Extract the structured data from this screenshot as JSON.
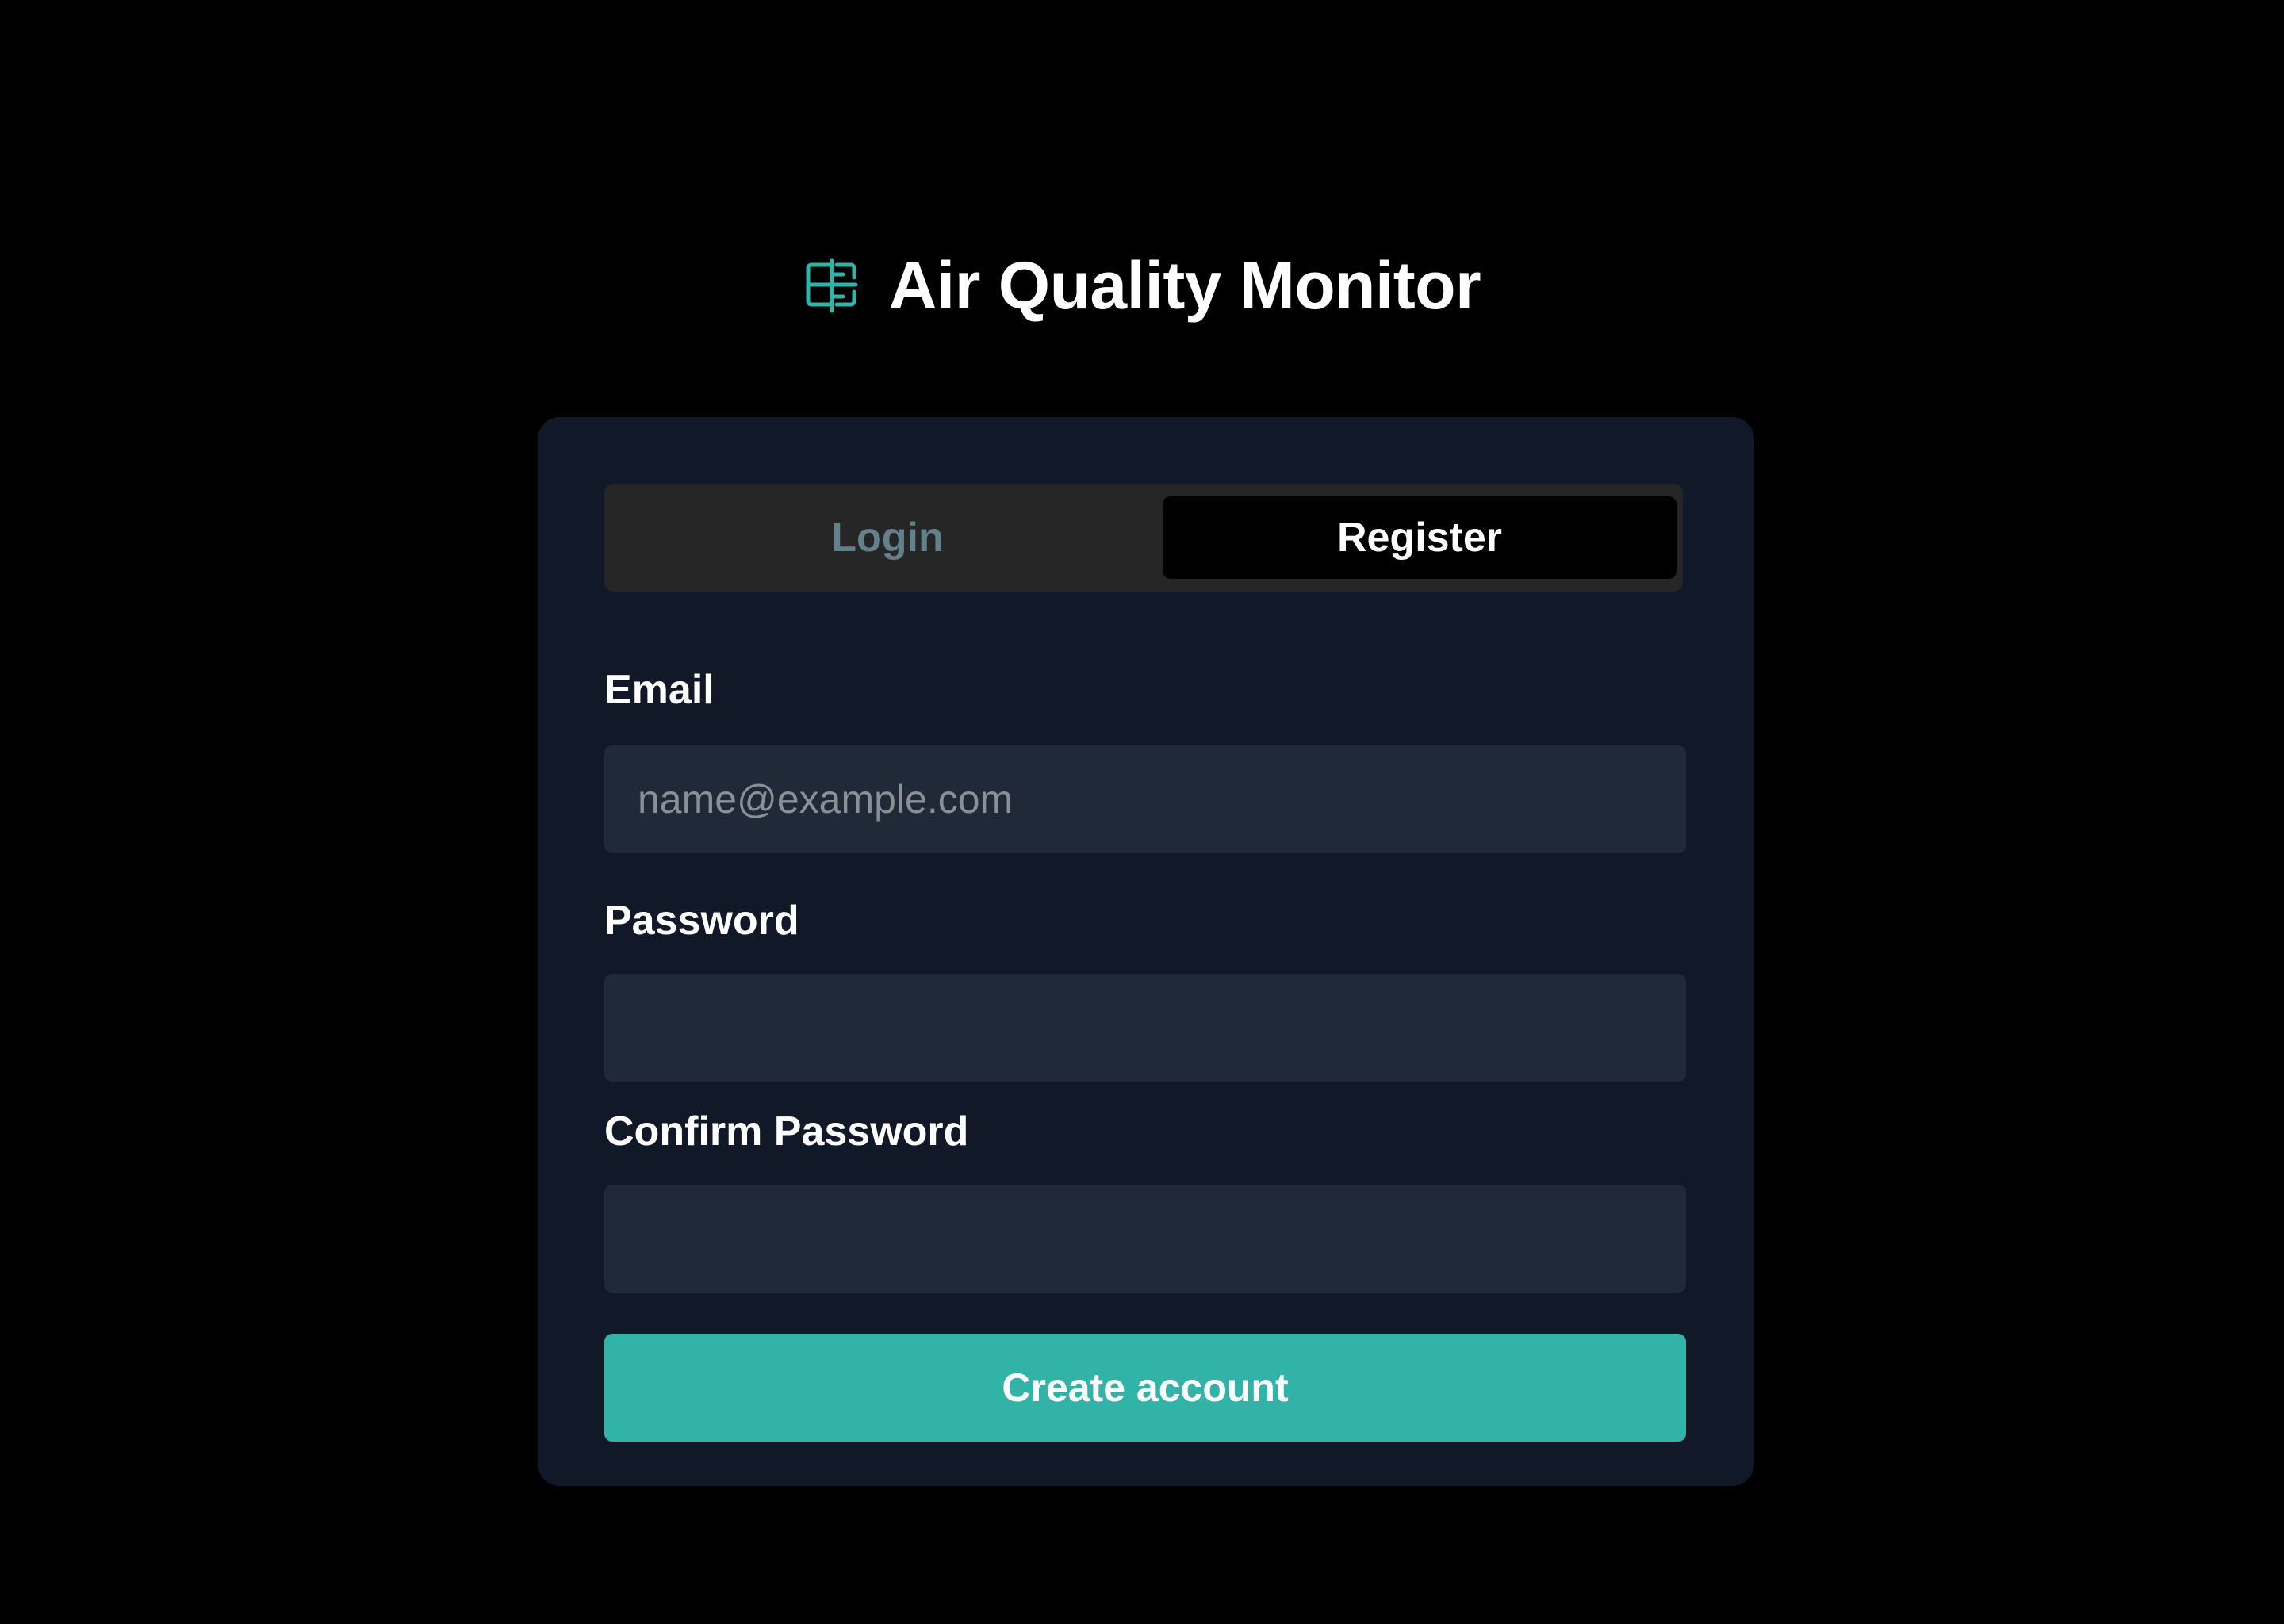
{
  "app": {
    "title": "Air Quality Monitor",
    "icon": "air-filter-icon",
    "accent_color": "#32b3a8"
  },
  "tabs": [
    {
      "label": "Login",
      "active": false
    },
    {
      "label": "Register",
      "active": true
    }
  ],
  "form": {
    "email": {
      "label": "Email",
      "value": "",
      "placeholder": "name@example.com"
    },
    "password": {
      "label": "Password",
      "value": "",
      "placeholder": ""
    },
    "confirm_password": {
      "label": "Confirm Password",
      "value": "",
      "placeholder": ""
    },
    "submit_label": "Create account"
  },
  "colors": {
    "background": "#000000",
    "card": "#111827",
    "input": "#1f2937",
    "tab_track": "#262626",
    "inactive_tab_text": "#64808a"
  }
}
